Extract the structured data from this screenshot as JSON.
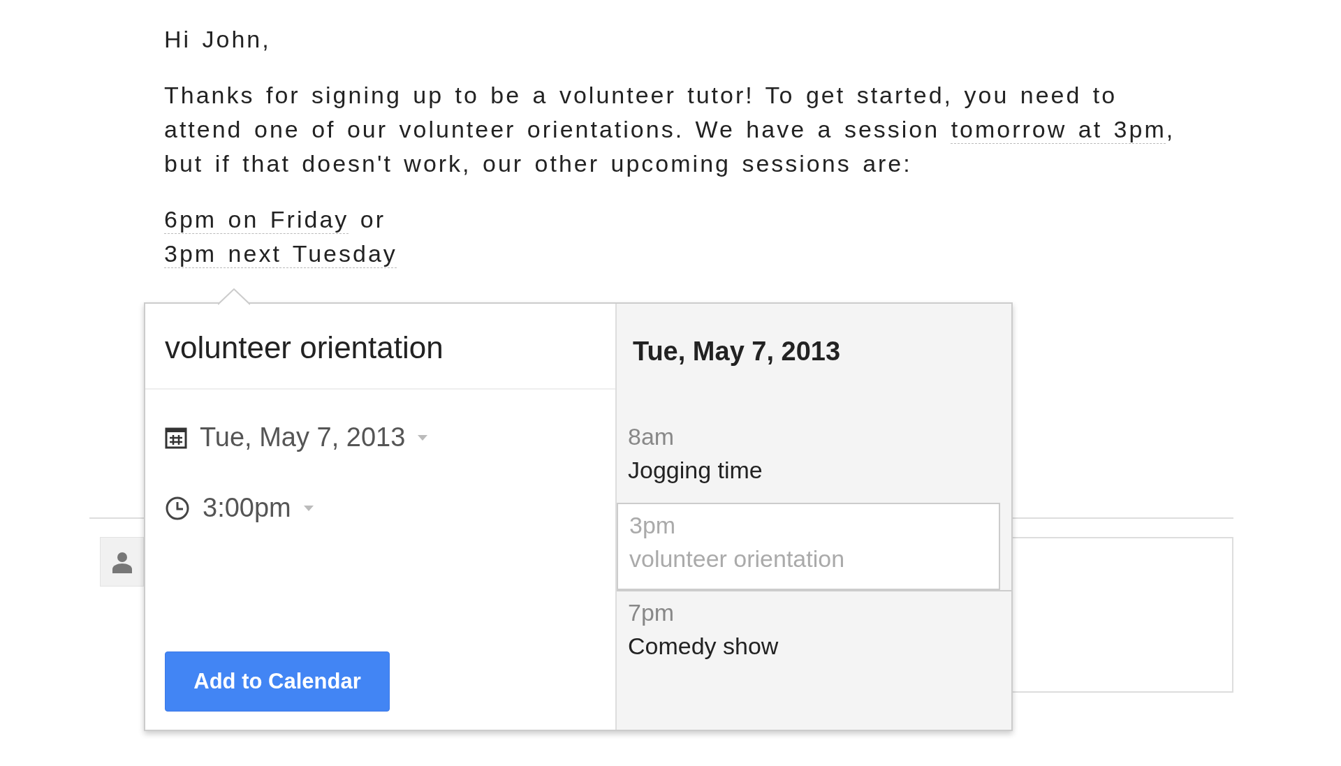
{
  "email": {
    "greeting": "Hi John,",
    "paragraph": [
      {
        "kind": "text",
        "text": "Thanks for signing up to be a volunteer tutor! To get started, you need to attend one of our volunteer orientations. We have a session "
      },
      {
        "kind": "date",
        "text": "tomorrow at 3pm"
      },
      {
        "kind": "text",
        "text": ", but if that doesn't work, our other upcoming sessions are:"
      }
    ],
    "lines": [
      [
        {
          "kind": "date",
          "text": "6pm on Friday"
        },
        {
          "kind": "text",
          "text": " or"
        }
      ],
      [
        {
          "kind": "date",
          "text": "3pm next Tuesday"
        }
      ]
    ]
  },
  "popup": {
    "title": "volunteer orientation",
    "date": "Tue, May 7, 2013",
    "time": "3:00pm",
    "button": "Add to Calendar",
    "day": {
      "heading": "Tue, May 7, 2013",
      "events": [
        {
          "time": "8am",
          "title": "Jogging time",
          "selected": false
        },
        {
          "time": "3pm",
          "title": "volunteer orientation",
          "selected": true
        },
        {
          "time": "7pm",
          "title": "Comedy show",
          "selected": false
        }
      ]
    }
  }
}
